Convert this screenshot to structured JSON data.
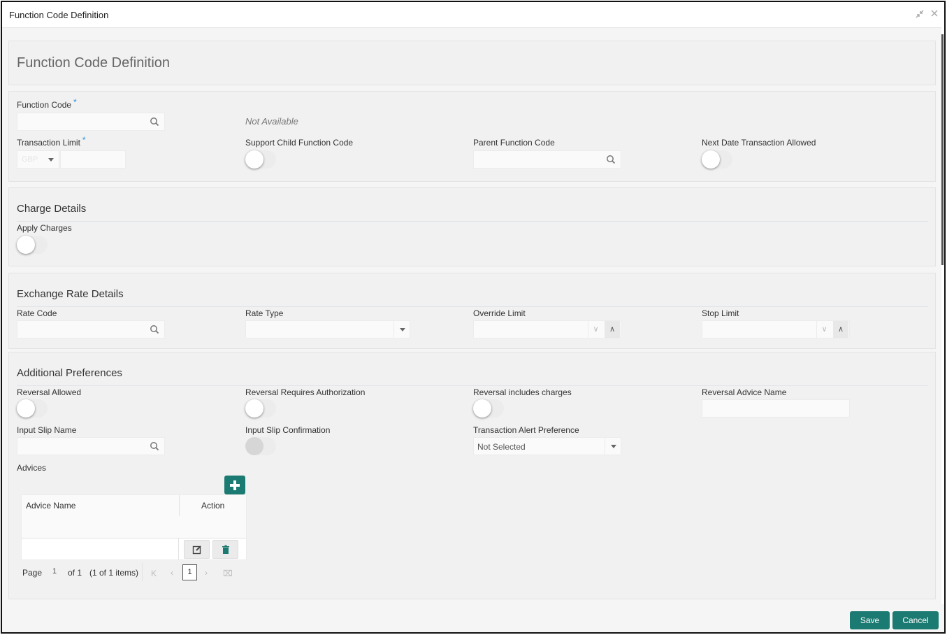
{
  "window": {
    "title": "Function Code Definition",
    "minimize_icon": "collapse-arrows-icon",
    "close_icon": "close-icon"
  },
  "header": {
    "page_title": "Function Code Definition"
  },
  "main": {
    "function_code": {
      "label": "Function Code",
      "required_mark": "*",
      "value": "",
      "status_text": "Not Available"
    },
    "transaction_limit": {
      "label": "Transaction Limit",
      "required_mark": "*",
      "currency_placeholder": "GBP",
      "amount": ""
    },
    "support_child_function_code": {
      "label": "Support Child Function Code",
      "on": false
    },
    "parent_function_code": {
      "label": "Parent Function Code",
      "value": ""
    },
    "next_date_transaction_allowed": {
      "label": "Next Date Transaction Allowed",
      "on": false
    }
  },
  "charge_details": {
    "title": "Charge Details",
    "apply_charges": {
      "label": "Apply Charges",
      "on": false
    }
  },
  "exchange_rate_details": {
    "title": "Exchange Rate Details",
    "rate_code": {
      "label": "Rate Code",
      "value": ""
    },
    "rate_type": {
      "label": "Rate Type",
      "value": ""
    },
    "override_limit": {
      "label": "Override Limit",
      "value": ""
    },
    "stop_limit": {
      "label": "Stop Limit",
      "value": ""
    }
  },
  "additional_preferences": {
    "title": "Additional Preferences",
    "reversal_allowed": {
      "label": "Reversal Allowed",
      "on": false
    },
    "reversal_requires_authorization": {
      "label": "Reversal Requires Authorization",
      "on": false
    },
    "reversal_includes_charges": {
      "label": "Reversal includes charges",
      "on": false
    },
    "reversal_advice_name": {
      "label": "Reversal Advice Name",
      "value": ""
    },
    "input_slip_name": {
      "label": "Input Slip Name",
      "value": ""
    },
    "input_slip_confirmation": {
      "label": "Input Slip Confirmation",
      "on": false,
      "disabled": true
    },
    "transaction_alert_preference": {
      "label": "Transaction Alert Preference",
      "value": "Not Selected"
    },
    "advices": {
      "label": "Advices",
      "columns": [
        "Advice Name",
        "Action"
      ],
      "rows": [
        {
          "advice_name": ""
        }
      ],
      "pager": {
        "page_label": "Page",
        "page": "1",
        "of_label": "of 1",
        "items_label": "(1 of 1 items)",
        "current": "1"
      }
    }
  },
  "footer": {
    "save_label": "Save",
    "cancel_label": "Cancel"
  },
  "colors": {
    "accent": "#1b7a71",
    "required": "#2b8fd6"
  }
}
